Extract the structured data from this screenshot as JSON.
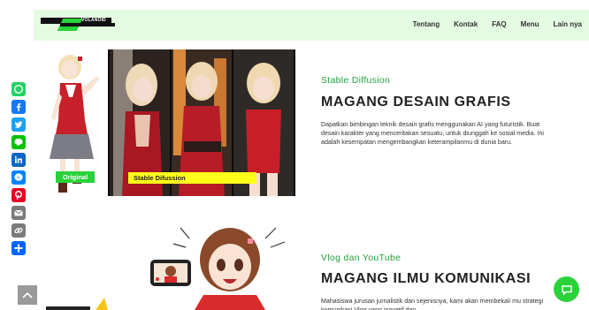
{
  "header": {
    "logo_text": "VOLANOID",
    "nav": [
      "Tentang",
      "Kontak",
      "FAQ",
      "Menu",
      "Lain nya"
    ]
  },
  "share_icons": [
    "whatsapp-icon",
    "facebook-icon",
    "twitter-icon",
    "line-icon",
    "linkedin-icon",
    "messenger-icon",
    "pinterest-icon",
    "email-icon",
    "copy-link-icon",
    "share-plus-icon"
  ],
  "section1": {
    "kicker": "Stable Diffusion",
    "title": "MAGANG DESAIN GRAFIS",
    "description": "Dapatkan bimbingan teknik desain grafis menggunakan AI yang futuristik. Buat desain karakter yang menceritakan sesuatu, untuk diunggah ke sosial media. Ini adalah kesempatan mengembangkan keterampilanmu di dunia baru.",
    "label_original": "Original",
    "label_sd": "Stable Difussion"
  },
  "section2": {
    "kicker": "Vlog dan YouTube",
    "title": "MAGANG ILMU KOMUNIKASI",
    "description": "Mahasiswa jurusan  jurnalistik dan sejenisnya, kami akan membekali mu strategi komunikasi Vlog yang inovatif dan"
  },
  "colors": {
    "accent": "#2ad23a",
    "header_bg": "#e3fbe0",
    "label_yellow": "#ffff1a"
  }
}
